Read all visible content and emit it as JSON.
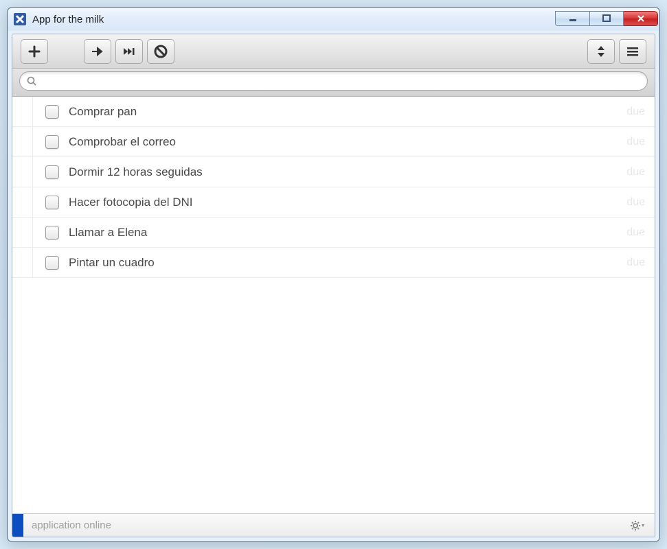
{
  "window": {
    "title": "App for the milk"
  },
  "toolbar": {
    "search_placeholder": ""
  },
  "tasks": [
    {
      "text": "Comprar pan",
      "due": "due"
    },
    {
      "text": "Comprobar el correo",
      "due": "due"
    },
    {
      "text": "Dormir 12 horas seguidas",
      "due": "due"
    },
    {
      "text": "Hacer fotocopia del DNI",
      "due": "due"
    },
    {
      "text": "Llamar a Elena",
      "due": "due"
    },
    {
      "text": "Pintar un cuadro",
      "due": "due"
    }
  ],
  "status": {
    "text": "application online"
  }
}
